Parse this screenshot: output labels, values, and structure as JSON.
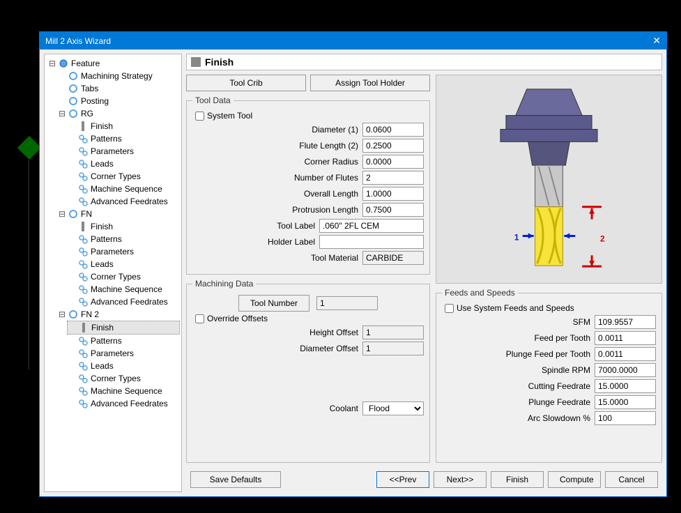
{
  "window": {
    "title": "Mill 2 Axis Wizard"
  },
  "tree": {
    "root": "Feature",
    "nodes": {
      "machining_strategy": "Machining Strategy",
      "tabs": "Tabs",
      "posting": "Posting",
      "rg": "RG",
      "fn": "FN",
      "fn2": "FN 2",
      "finish": "Finish",
      "patterns": "Patterns",
      "parameters": "Parameters",
      "leads": "Leads",
      "corner_types": "Corner Types",
      "machine_sequence": "Machine Sequence",
      "advanced_feedrates": "Advanced Feedrates"
    }
  },
  "pane": {
    "title": "Finish",
    "buttons": {
      "tool_crib": "Tool Crib",
      "assign_holder": "Assign Tool Holder"
    }
  },
  "tool_data": {
    "legend": "Tool Data",
    "system_tool_label": "System Tool",
    "fields": {
      "diameter_label": "Diameter (1)",
      "diameter": "0.0600",
      "flute_len_label": "Flute Length (2)",
      "flute_len": "0.2500",
      "corner_radius_label": "Corner Radius",
      "corner_radius": "0.0000",
      "num_flutes_label": "Number of Flutes",
      "num_flutes": "2",
      "overall_len_label": "Overall Length",
      "overall_len": "1.0000",
      "protrusion_len_label": "Protrusion Length",
      "protrusion_len": "0.7500",
      "tool_label_label": "Tool Label",
      "tool_label": ".060\" 2FL CEM",
      "holder_label_label": "Holder Label",
      "holder_label": "",
      "tool_material_label": "Tool Material",
      "tool_material": "CARBIDE"
    }
  },
  "machining_data": {
    "legend": "Machining Data",
    "tool_number_btn": "Tool Number",
    "tool_number": "1",
    "override_offsets_label": "Override Offsets",
    "height_offset_label": "Height Offset",
    "height_offset": "1",
    "diameter_offset_label": "Diameter Offset",
    "diameter_offset": "1",
    "coolant_label": "Coolant",
    "coolant": "Flood"
  },
  "preview": {
    "dim1": "1",
    "dim2": "2"
  },
  "feeds": {
    "legend": "Feeds and Speeds",
    "use_system_label": "Use System Feeds and Speeds",
    "sfm_label": "SFM",
    "sfm": "109.9557",
    "fpt_label": "Feed per Tooth",
    "fpt": "0.0011",
    "pfpt_label": "Plunge Feed per Tooth",
    "pfpt": "0.0011",
    "rpm_label": "Spindle RPM",
    "rpm": "7000.0000",
    "cut_fr_label": "Cutting Feedrate",
    "cut_fr": "15.0000",
    "plunge_fr_label": "Plunge Feedrate",
    "plunge_fr": "15.0000",
    "arc_slow_label": "Arc Slowdown %",
    "arc_slow": "100"
  },
  "footer": {
    "save_defaults": "Save Defaults",
    "prev": "<<Prev",
    "next": "Next>>",
    "finish": "Finish",
    "compute": "Compute",
    "cancel": "Cancel"
  }
}
